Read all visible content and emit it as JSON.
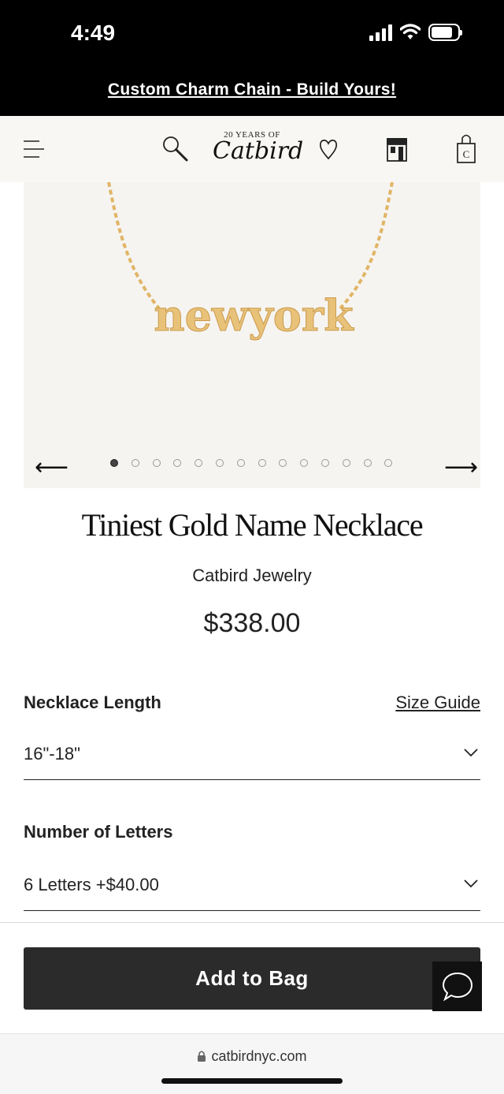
{
  "status": {
    "time": "4:49"
  },
  "banner": {
    "text": "Custom Charm Chain - Build Yours!"
  },
  "header": {
    "logo_small": "20 YEARS OF",
    "logo_script": "Catbird",
    "icons": [
      "menu-icon",
      "search-icon",
      "heart-icon",
      "store-icon",
      "bag-icon"
    ]
  },
  "gallery": {
    "image_text": "newyork",
    "slide_count": 14,
    "active_index": 0
  },
  "product": {
    "title": "Tiniest Gold Name Necklace",
    "brand": "Catbird Jewelry",
    "price": "$338.00"
  },
  "options": {
    "length_label": "Necklace Length",
    "size_guide": "Size Guide",
    "length_value": "16\"-18\"",
    "letters_label": "Number of Letters",
    "letters_value": "6 Letters +$40.00"
  },
  "cta": {
    "add_to_bag": "Add to Bag"
  },
  "browser": {
    "url": "catbirdnyc.com"
  },
  "colors": {
    "banner_bg": "#000000",
    "header_bg": "#f9f7f3",
    "button_bg": "#2b2b2b",
    "gold": "#e8bf73"
  }
}
